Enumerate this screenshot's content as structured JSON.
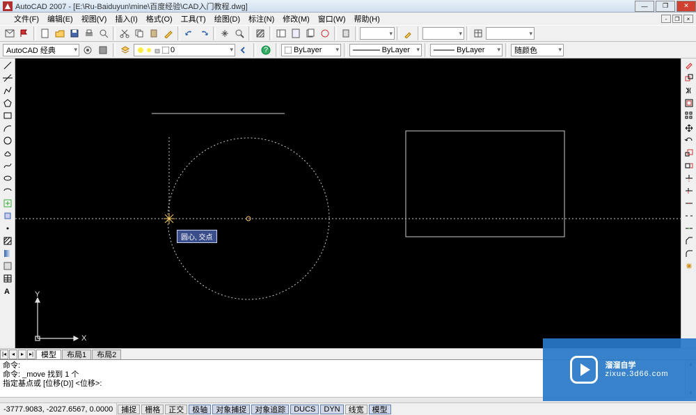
{
  "window": {
    "title": "AutoCAD 2007 - [E:\\Ru-Baiduyun\\mine\\百度经验\\CAD入门教程.dwg]"
  },
  "menu": [
    "文件(F)",
    "编辑(E)",
    "视图(V)",
    "插入(I)",
    "格式(O)",
    "工具(T)",
    "绘图(D)",
    "标注(N)",
    "修改(M)",
    "窗口(W)",
    "帮助(H)"
  ],
  "toolbar_top_icons": [
    "new",
    "open",
    "save",
    "print",
    "plot-preview",
    "cut",
    "copy",
    "paste",
    "match-prop",
    "undo",
    "redo",
    "pan",
    "zoom-realtime",
    "zoom-window",
    "zoom-prev",
    "properties",
    "design-center",
    "tool-palettes",
    "sheet-set",
    "markup",
    "calc",
    "help"
  ],
  "workspace": {
    "label": "AutoCAD 经典",
    "layer_state": "0",
    "bylayer_color": "ByLayer",
    "bylayer_linetype": "ByLayer",
    "bylayer_lineweight": "ByLayer",
    "color_control": "随颜色"
  },
  "left_tools": [
    "line",
    "xline",
    "pline",
    "polygon",
    "rectangle",
    "arc",
    "circle",
    "revcloud",
    "spline",
    "ellipse",
    "ellipse-arc",
    "insert",
    "block",
    "point",
    "hatch",
    "gradient",
    "region",
    "table",
    "mtext"
  ],
  "right_tools": [
    "dist",
    "area",
    "erase",
    "copy",
    "mirror",
    "offset",
    "array",
    "move",
    "rotate",
    "scale",
    "stretch",
    "trim",
    "extend",
    "break-at",
    "break",
    "join",
    "chamfer",
    "fillet",
    "explode"
  ],
  "canvas": {
    "tooltip": "圆心, 交点",
    "ucs_x": "X",
    "ucs_y": "Y"
  },
  "tabs": [
    "模型",
    "布局1",
    "布局2"
  ],
  "command": {
    "line1": "命令:",
    "line2": "命令: _move 找到 1 个",
    "line3": "指定基点或 [位移(D)] <位移>:"
  },
  "status": {
    "coords": "-3777.9083, -2027.6567, 0.0000",
    "buttons": [
      "捕捉",
      "栅格",
      "正交",
      "极轴",
      "对象捕捉",
      "对象追踪",
      "DUCS",
      "DYN",
      "线宽",
      "模型"
    ]
  },
  "watermark": {
    "brand": "溜溜自学",
    "url": "zixue.3d66.com"
  }
}
